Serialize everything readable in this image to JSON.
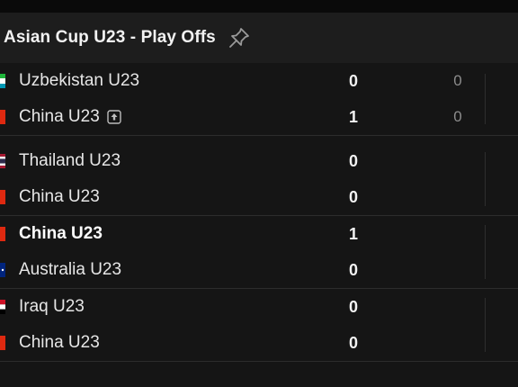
{
  "header": {
    "title": "Asian Cup U23 - Play Offs",
    "pin_icon": "pin-icon"
  },
  "colors": {
    "background": "#151515",
    "header_bg": "#1d1d1d",
    "divider": "#2c2c2c",
    "secondary_text": "#8c8c8c"
  },
  "matches": [
    {
      "teams": [
        {
          "name": "Uzbekistan U23",
          "score": "0",
          "agg": "0",
          "flag": "flag-uzbekistan",
          "winner": false,
          "promo": false
        },
        {
          "name": "China U23",
          "score": "1",
          "agg": "0",
          "flag": "flag-china",
          "winner": false,
          "promo": true
        }
      ]
    },
    {
      "teams": [
        {
          "name": "Thailand U23",
          "score": "0",
          "flag": "flag-thailand",
          "winner": false
        },
        {
          "name": "China U23",
          "score": "0",
          "flag": "flag-china",
          "winner": false
        }
      ]
    },
    {
      "teams": [
        {
          "name": "China U23",
          "score": "1",
          "flag": "flag-china",
          "winner": true
        },
        {
          "name": "Australia U23",
          "score": "0",
          "flag": "flag-australia",
          "winner": false
        }
      ]
    },
    {
      "teams": [
        {
          "name": "Iraq U23",
          "score": "0",
          "flag": "flag-iraq",
          "winner": false
        },
        {
          "name": "China U23",
          "score": "0",
          "flag": "flag-china",
          "winner": false
        }
      ]
    }
  ]
}
